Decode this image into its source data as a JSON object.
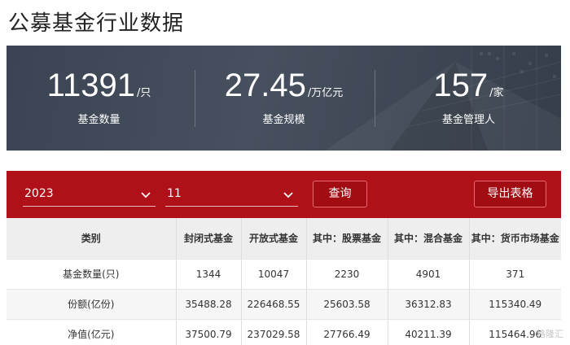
{
  "page": {
    "title": "公募基金行业数据"
  },
  "stats": [
    {
      "value": "11391",
      "unit": "/只",
      "label": "基金数量"
    },
    {
      "value": "27.45",
      "unit": "/万亿元",
      "label": "基金规模"
    },
    {
      "value": "157",
      "unit": "/家",
      "label": "基金管理人"
    }
  ],
  "filters": {
    "year": "2023",
    "month": "11",
    "query_label": "查询",
    "export_label": "导出表格"
  },
  "table": {
    "headers": [
      "类别",
      "封闭式基金",
      "开放式基金",
      "其中：股票基金",
      "其中：混合基金",
      "其中：货币市场基金"
    ],
    "rows": [
      [
        "基金数量(只)",
        "1344",
        "10047",
        "2230",
        "4901",
        "371"
      ],
      [
        "份额(亿份)",
        "35488.28",
        "226468.55",
        "25603.58",
        "36312.83",
        "115340.49"
      ],
      [
        "净值(亿元)",
        "37500.79",
        "237029.58",
        "27766.49",
        "40211.39",
        "115464.96"
      ]
    ]
  },
  "watermark": "格隆汇",
  "colors": {
    "banner_bg": "#3f4957",
    "filter_bar": "#b01018",
    "header_bg": "#eeeeee"
  },
  "icons": {
    "dropdown": "chevron-down-icon"
  }
}
